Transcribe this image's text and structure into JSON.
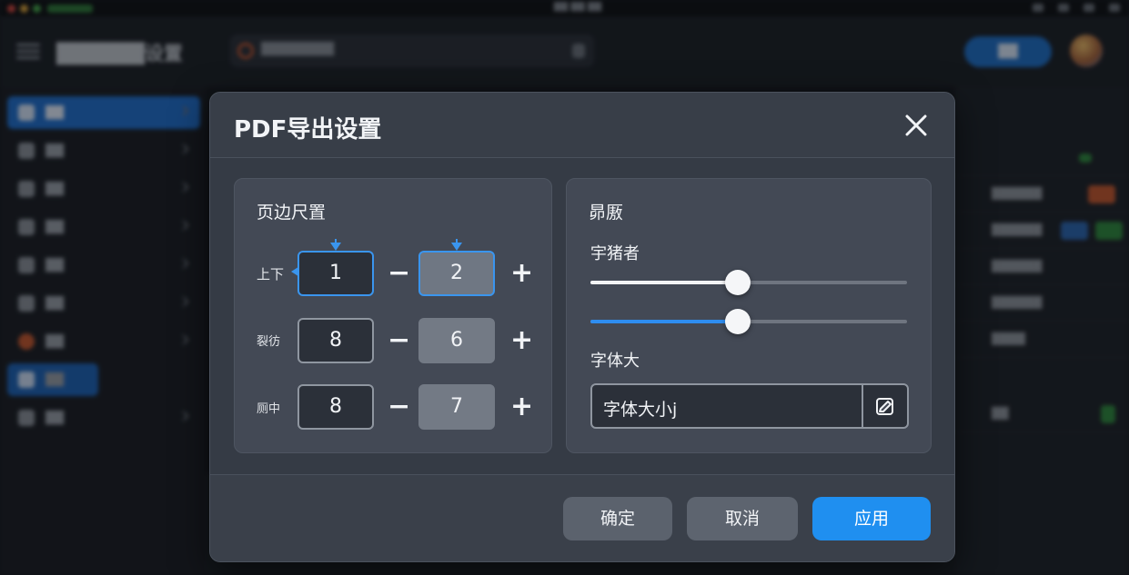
{
  "background": {
    "system_bar_title": "██ ██ ██",
    "app_title": "██████设置",
    "search_placeholder": "████████",
    "top_button": "██",
    "sidebar_items": [
      "██",
      "██",
      "██",
      "██",
      "██",
      "██",
      "██",
      "██",
      "██"
    ],
    "content_rows": [
      "",
      "██████",
      "██████",
      "██████",
      "██████",
      "████",
      "██"
    ],
    "bottom_text": "████"
  },
  "dialog": {
    "title": "PDF导出设置",
    "close_icon": "close-icon",
    "left_panel": {
      "title": "页边尺置",
      "rows": [
        {
          "label": "上下",
          "value_a": "1",
          "value_b": "2",
          "minus": "−",
          "plus": "+"
        },
        {
          "label": "裂彷",
          "value_a": "8",
          "value_b": "6",
          "minus": "−",
          "plus": "+"
        },
        {
          "label": "厕中",
          "value_a": "8",
          "value_b": "7",
          "minus": "−",
          "plus": "+"
        }
      ]
    },
    "right_panel": {
      "title": "昴厫",
      "slider_label": "宇猪者",
      "sliders": [
        {
          "value_fraction": 0.465,
          "fill_color": "#f3f4f6"
        },
        {
          "value_fraction": 0.465,
          "fill_color": "#2e8df0"
        }
      ],
      "font_size_label": "字体大",
      "font_size_value": "字体大小j",
      "edit_icon": "edit-icon"
    },
    "buttons": {
      "ok": "确定",
      "cancel": "取消",
      "apply": "应用"
    }
  },
  "colors": {
    "accent": "#1f8ff0",
    "focus_border": "#3a95ee"
  }
}
